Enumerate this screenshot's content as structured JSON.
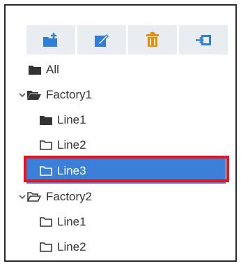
{
  "toolbar": {
    "buttons": [
      {
        "name": "new-folder-button",
        "icon": "folder-plus-icon"
      },
      {
        "name": "edit-button",
        "icon": "edit-icon"
      },
      {
        "name": "delete-button",
        "icon": "trash-icon"
      },
      {
        "name": "move-button",
        "icon": "import-icon"
      }
    ]
  },
  "tree": {
    "all": {
      "label": "All"
    },
    "factory1": {
      "label": "Factory1",
      "expanded": true,
      "lines": [
        {
          "label": "Line1",
          "icon": "folder-filled-icon"
        },
        {
          "label": "Line2",
          "icon": "folder-outline-icon"
        },
        {
          "label": "Line3",
          "icon": "folder-outline-icon",
          "selected": true
        }
      ]
    },
    "factory2": {
      "label": "Factory2",
      "expanded": true,
      "lines": [
        {
          "label": "Line1",
          "icon": "folder-outline-icon"
        },
        {
          "label": "Line2",
          "icon": "folder-outline-icon"
        }
      ]
    }
  },
  "colors": {
    "accent_blue": "#3b7fd9",
    "toolbar_bg": "#e9edf2",
    "delete_orange": "#f08a00",
    "highlight_red": "#e8141b",
    "text": "#333333"
  }
}
